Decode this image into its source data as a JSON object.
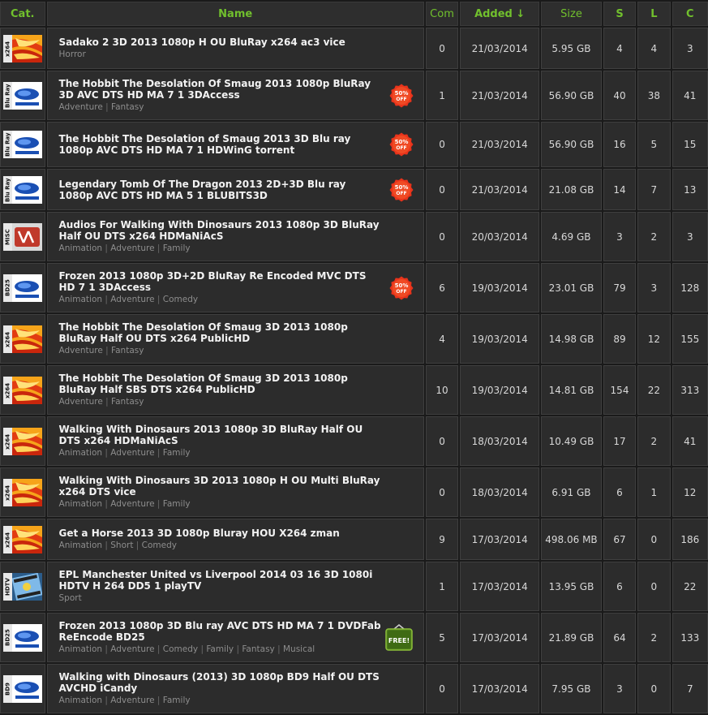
{
  "header": {
    "cat": "Cat.",
    "name": "Name",
    "com": "Com",
    "added": "Added ↓",
    "size": "Size",
    "s": "S",
    "l": "L",
    "c": "C"
  },
  "colors": {
    "accent_green": "#71c02d",
    "row_bg": "#2c2c2c",
    "page_bg": "#1a1a1a"
  },
  "rows": [
    {
      "cat": "x264",
      "name": "Sadako 2 3D 2013 1080p H OU BluRay x264 ac3 vice",
      "genres": [
        "Horror"
      ],
      "badge": "",
      "com": "0",
      "added": "21/03/2014",
      "size": "5.95 GB",
      "s": "4",
      "l": "4",
      "c": "3"
    },
    {
      "cat": "Blu Ray",
      "name": "The Hobbit The Desolation Of Smaug 2013 1080p BluRay 3D AVC DTS HD MA 7 1 3DAccess",
      "genres": [
        "Adventure",
        "Fantasy"
      ],
      "badge": "50% OFF",
      "com": "1",
      "added": "21/03/2014",
      "size": "56.90 GB",
      "s": "40",
      "l": "38",
      "c": "41"
    },
    {
      "cat": "Blu Ray",
      "name": "The Hobbit The Desolation of Smaug 2013 3D Blu ray 1080p AVC DTS HD MA 7 1 HDWinG torrent",
      "genres": [],
      "badge": "50% OFF",
      "com": "0",
      "added": "21/03/2014",
      "size": "56.90 GB",
      "s": "16",
      "l": "5",
      "c": "15"
    },
    {
      "cat": "Blu Ray",
      "name": "Legendary Tomb Of The Dragon 2013 2D+3D Blu ray 1080p AVC DTS HD MA 5 1 BLUBITS3D",
      "genres": [],
      "badge": "50% OFF",
      "com": "0",
      "added": "21/03/2014",
      "size": "21.08 GB",
      "s": "14",
      "l": "7",
      "c": "13"
    },
    {
      "cat": "MISC",
      "name": "Audios For Walking With Dinosaurs 2013 1080p 3D BluRay Half OU DTS x264 HDMaNiAcS",
      "genres": [
        "Animation",
        "Adventure",
        "Family"
      ],
      "badge": "",
      "com": "0",
      "added": "20/03/2014",
      "size": "4.69 GB",
      "s": "3",
      "l": "2",
      "c": "3"
    },
    {
      "cat": "BD25",
      "name": "Frozen 2013 1080p 3D+2D BluRay Re Encoded MVC DTS HD 7 1 3DAccess",
      "genres": [
        "Animation",
        "Adventure",
        "Comedy"
      ],
      "badge": "50% OFF",
      "com": "6",
      "added": "19/03/2014",
      "size": "23.01 GB",
      "s": "79",
      "l": "3",
      "c": "128"
    },
    {
      "cat": "x264",
      "name": "The Hobbit The Desolation Of Smaug 3D 2013 1080p BluRay Half OU DTS x264 PublicHD",
      "genres": [
        "Adventure",
        "Fantasy"
      ],
      "badge": "",
      "com": "4",
      "added": "19/03/2014",
      "size": "14.98 GB",
      "s": "89",
      "l": "12",
      "c": "155"
    },
    {
      "cat": "x264",
      "name": "The Hobbit The Desolation Of Smaug 3D 2013 1080p BluRay Half SBS DTS x264 PublicHD",
      "genres": [
        "Adventure",
        "Fantasy"
      ],
      "badge": "",
      "com": "10",
      "added": "19/03/2014",
      "size": "14.81 GB",
      "s": "154",
      "l": "22",
      "c": "313"
    },
    {
      "cat": "x264",
      "name": "Walking With Dinosaurs 2013 1080p 3D BluRay Half OU DTS x264 HDMaNiAcS",
      "genres": [
        "Animation",
        "Adventure",
        "Family"
      ],
      "badge": "",
      "com": "0",
      "added": "18/03/2014",
      "size": "10.49 GB",
      "s": "17",
      "l": "2",
      "c": "41"
    },
    {
      "cat": "x264",
      "name": "Walking With Dinosaurs 3D 2013 1080p H OU Multi BluRay x264 DTS vice",
      "genres": [
        "Animation",
        "Adventure",
        "Family"
      ],
      "badge": "",
      "com": "0",
      "added": "18/03/2014",
      "size": "6.91 GB",
      "s": "6",
      "l": "1",
      "c": "12"
    },
    {
      "cat": "x264",
      "name": "Get a Horse 2013 3D 1080p Bluray HOU X264 zman",
      "genres": [
        "Animation",
        "Short",
        "Comedy"
      ],
      "badge": "",
      "com": "9",
      "added": "17/03/2014",
      "size": "498.06 MB",
      "s": "67",
      "l": "0",
      "c": "186"
    },
    {
      "cat": "HDTV",
      "name": "EPL Manchester United vs Liverpool 2014 03 16 3D 1080i HDTV H 264 DD5 1 playTV",
      "genres": [
        "Sport"
      ],
      "badge": "",
      "com": "1",
      "added": "17/03/2014",
      "size": "13.95 GB",
      "s": "6",
      "l": "0",
      "c": "22"
    },
    {
      "cat": "BD25",
      "name": "Frozen 2013 1080p 3D Blu ray AVC DTS HD MA 7 1 DVDFab ReEncode BD25",
      "genres": [
        "Animation",
        "Adventure",
        "Comedy",
        "Family",
        "Fantasy",
        "Musical"
      ],
      "badge": "FREE!",
      "com": "5",
      "added": "17/03/2014",
      "size": "21.89 GB",
      "s": "64",
      "l": "2",
      "c": "133"
    },
    {
      "cat": "BD9",
      "name": "Walking with Dinosaurs (2013) 3D 1080p BD9 Half OU DTS AVCHD iCandy",
      "genres": [
        "Animation",
        "Adventure",
        "Family"
      ],
      "badge": "",
      "com": "0",
      "added": "17/03/2014",
      "size": "7.95 GB",
      "s": "3",
      "l": "0",
      "c": "7"
    }
  ]
}
